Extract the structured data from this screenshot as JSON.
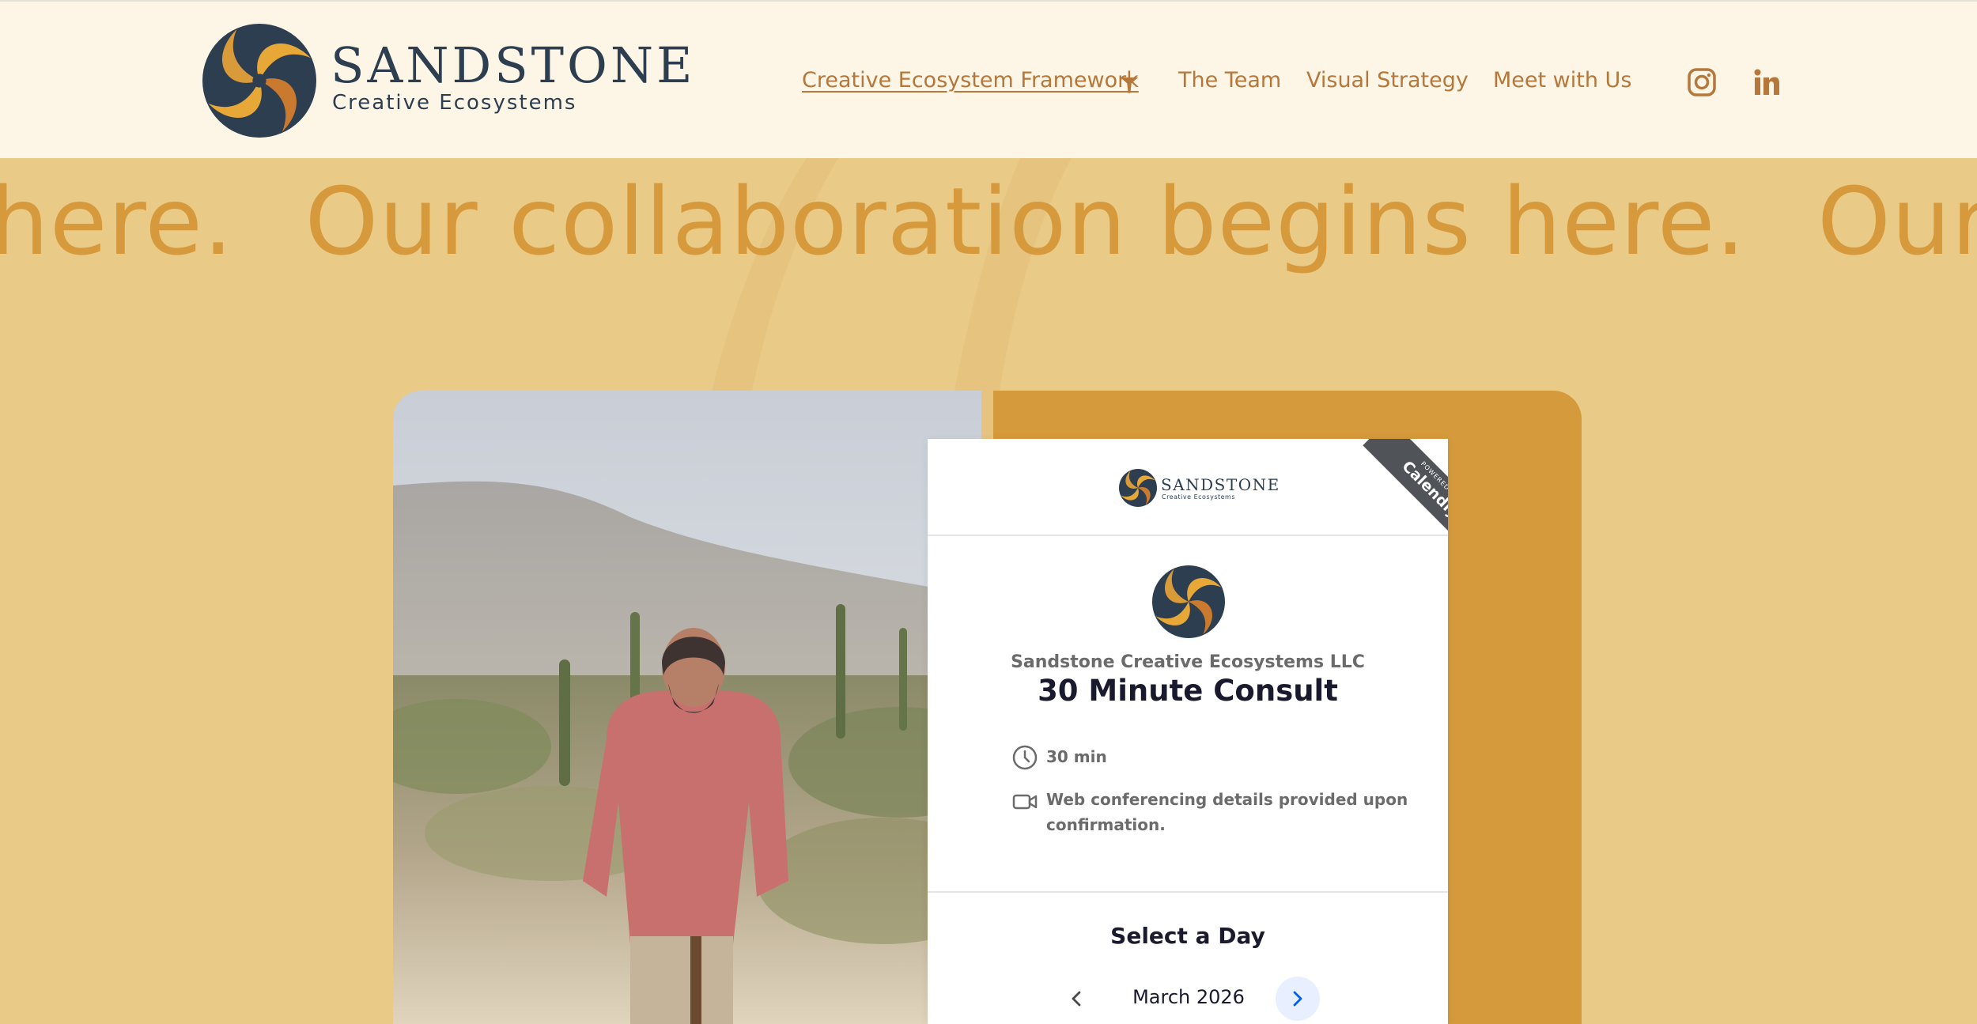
{
  "brand": {
    "name": "SANDSTONE",
    "tagline": "Creative Ecosystems"
  },
  "nav": {
    "items": [
      {
        "label": "Creative Ecosystem Framework",
        "active": true,
        "has_dropdown": true
      },
      {
        "label": "The Team"
      },
      {
        "label": "Visual Strategy"
      },
      {
        "label": "Meet with Us"
      }
    ],
    "social": [
      "instagram-icon",
      "linkedin-icon"
    ]
  },
  "hero": {
    "marquee": [
      "s here.",
      "Our collaboration begins here.",
      "Our c"
    ]
  },
  "widget": {
    "logo_title": "SANDSTONE",
    "logo_sub": "Creative Ecosystems",
    "ribbon_small": "POWERED BY",
    "ribbon_big": "Calendly",
    "org_name": "Sandstone Creative Ecosystems LLC",
    "event_title": "30 Minute Consult",
    "duration": "30 min",
    "location_line1": "Web conferencing details provided upon",
    "location_line2": "confirmation.",
    "select_day": "Select a Day",
    "month": "March 2026"
  },
  "colors": {
    "header_bg": "#fdf6e7",
    "page_bg": "#e9cb87",
    "accent": "#d59a3b",
    "nav_text": "#b5773a",
    "navy": "#2c3e50"
  }
}
